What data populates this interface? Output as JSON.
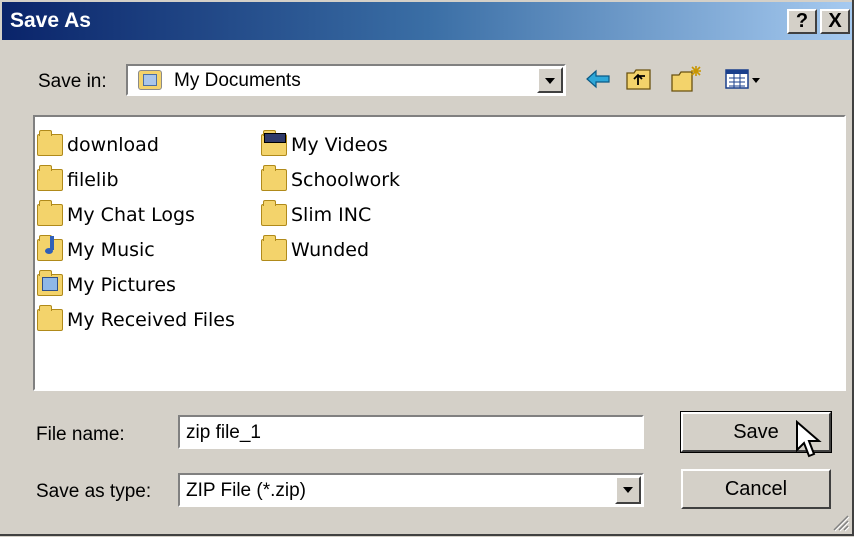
{
  "window": {
    "title": "Save As",
    "help_label": "?",
    "close_label": "X"
  },
  "toolbar": {
    "save_in_label": "Save in:",
    "location": "My Documents",
    "back_icon": "back-arrow-icon",
    "up_icon": "up-folder-icon",
    "new_folder_icon": "new-folder-icon",
    "view_icon": "view-menu-icon"
  },
  "files": {
    "column1": [
      {
        "name": "download",
        "icon": "folder-icon"
      },
      {
        "name": "filelib",
        "icon": "folder-icon"
      },
      {
        "name": "My Chat Logs",
        "icon": "folder-icon"
      },
      {
        "name": "My Music",
        "icon": "music-folder-icon"
      },
      {
        "name": "My Pictures",
        "icon": "pictures-folder-icon"
      },
      {
        "name": "My Received Files",
        "icon": "folder-icon"
      }
    ],
    "column2": [
      {
        "name": "My Videos",
        "icon": "videos-folder-icon"
      },
      {
        "name": "Schoolwork",
        "icon": "folder-icon"
      },
      {
        "name": "Slim INC",
        "icon": "folder-icon"
      },
      {
        "name": "Wunded",
        "icon": "folder-icon"
      }
    ]
  },
  "form": {
    "file_name_label": "File name:",
    "file_name_value": "zip file_1",
    "save_type_label": "Save as type:",
    "save_type_value": "ZIP File (*.zip)",
    "save_button": "Save",
    "cancel_button": "Cancel"
  }
}
